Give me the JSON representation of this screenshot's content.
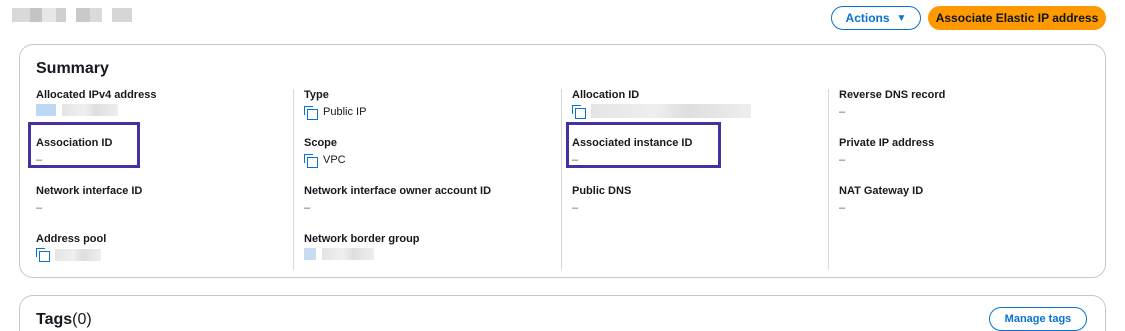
{
  "header": {
    "actions_label": "Actions",
    "associate_label": "Associate Elastic IP address"
  },
  "summary": {
    "title": "Summary",
    "fields": {
      "allocated_ipv4": {
        "label": "Allocated IPv4 address"
      },
      "association_id": {
        "label": "Association ID",
        "value": "–"
      },
      "network_interface_id": {
        "label": "Network interface ID",
        "value": "–"
      },
      "address_pool": {
        "label": "Address pool"
      },
      "type": {
        "label": "Type",
        "value": "Public IP"
      },
      "scope": {
        "label": "Scope",
        "value": "VPC"
      },
      "ni_owner_account_id": {
        "label": "Network interface owner account ID",
        "value": "–"
      },
      "network_border_group": {
        "label": "Network border group"
      },
      "allocation_id": {
        "label": "Allocation ID"
      },
      "associated_instance_id": {
        "label": "Associated instance ID",
        "value": "–"
      },
      "public_dns": {
        "label": "Public DNS",
        "value": "–"
      },
      "reverse_dns_record": {
        "label": "Reverse DNS record",
        "value": "–"
      },
      "private_ip_address": {
        "label": "Private IP address",
        "value": "–"
      },
      "nat_gateway_id": {
        "label": "NAT Gateway ID",
        "value": "–"
      }
    }
  },
  "tags": {
    "title": "Tags",
    "count": "(0)",
    "manage_label": "Manage tags"
  },
  "colors": {
    "link_blue": "#0972d3",
    "primary_orange": "#ff9900",
    "highlight_purple": "#4631a3"
  }
}
